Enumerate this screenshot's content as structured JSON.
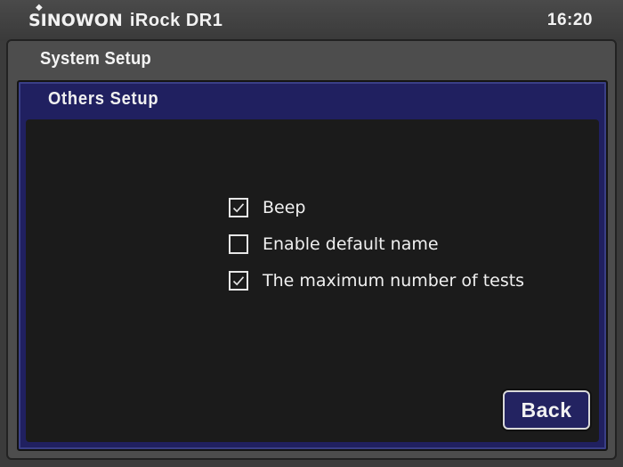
{
  "topbar": {
    "brand": "SINOWON",
    "model": "iRock DR1",
    "time": "16:20"
  },
  "window": {
    "title": "System Setup"
  },
  "panel": {
    "title": "Others  Setup",
    "options": [
      {
        "label": "Beep",
        "checked": true
      },
      {
        "label": "Enable default name",
        "checked": false
      },
      {
        "label": "The maximum number of tests",
        "checked": true
      }
    ],
    "back_label": "Back"
  },
  "colors": {
    "panel_blue": "#202060",
    "body_dark": "#1b1b1b",
    "frame_gray": "#4d4d4d",
    "text": "#f0f0f0"
  },
  "icons": {
    "checked": "check-icon",
    "logo": "sinowon-logo"
  }
}
